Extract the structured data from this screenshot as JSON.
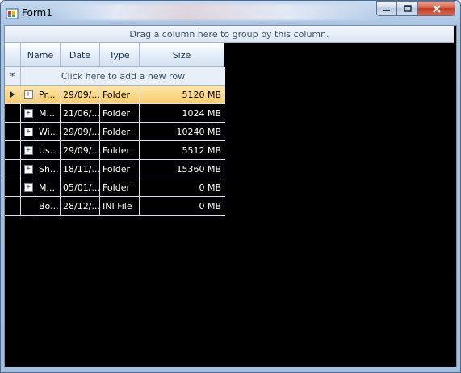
{
  "window": {
    "title": "Form1"
  },
  "grid": {
    "group_panel_text": "Drag a column here to group by this column.",
    "new_row_indicator": "*",
    "new_row_text": "Click here to add a new row",
    "columns": [
      {
        "label": "Name"
      },
      {
        "label": "Date"
      },
      {
        "label": "Type"
      },
      {
        "label": "Size"
      }
    ],
    "rows": [
      {
        "name": "Pr...",
        "date": "29/09/...",
        "type": "Folder",
        "size": "5120 MB",
        "selected": true,
        "has_children": true
      },
      {
        "name": "M...",
        "date": "21/06/...",
        "type": "Folder",
        "size": "1024 MB",
        "selected": false,
        "has_children": true
      },
      {
        "name": "Wi...",
        "date": "29/09/...",
        "type": "Folder",
        "size": "10240 MB",
        "selected": false,
        "has_children": true
      },
      {
        "name": "Us...",
        "date": "29/09/...",
        "type": "Folder",
        "size": "5512 MB",
        "selected": false,
        "has_children": true
      },
      {
        "name": "Sh...",
        "date": "18/11/...",
        "type": "Folder",
        "size": "15360 MB",
        "selected": false,
        "has_children": true
      },
      {
        "name": "M...",
        "date": "05/01/...",
        "type": "Folder",
        "size": "0 MB",
        "selected": false,
        "has_children": true
      },
      {
        "name": "Bo...",
        "date": "28/12/...",
        "type": "INI File",
        "size": "0 MB",
        "selected": false,
        "has_children": false
      }
    ]
  },
  "colors": {
    "selected_row": "#fbd98a",
    "client_background": "#000000",
    "header": "#dce6f2",
    "close_button": "#c7391f"
  }
}
